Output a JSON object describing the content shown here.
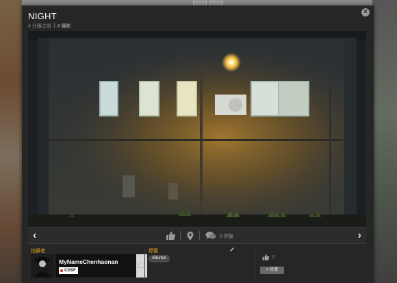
{
  "modal": {
    "title": "NIGHT",
    "posted_time": "4 分鐘之前",
    "category": "# 攝影",
    "close_glyph": "×"
  },
  "photo": {
    "description_colors": {
      "wall": "#3b3f42",
      "lamp": "#ffc34a",
      "window_light": "#d8e3df"
    }
  },
  "controls": {
    "prev_glyph": "‹",
    "next_glyph": "›",
    "comments_label": "0 評論"
  },
  "info": {
    "photographer_label": "拍攝者",
    "username": "MyNameChenhaonan",
    "badge": "CGSF",
    "tags_label": "標籤",
    "tag": "#Burton",
    "like_count": "0",
    "share_label": "分享"
  },
  "colors": {
    "accent": "#d4a017",
    "modal_bg": "#262626"
  }
}
